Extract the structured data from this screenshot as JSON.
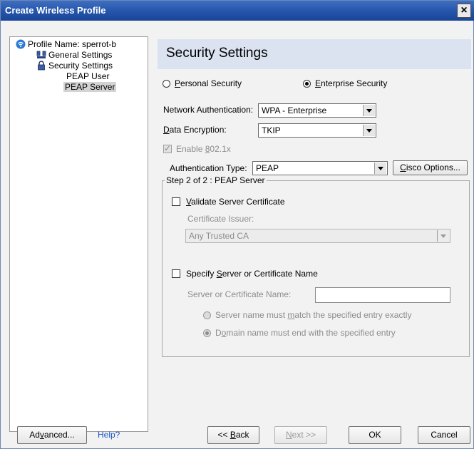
{
  "window": {
    "title": "Create Wireless Profile",
    "close_glyph": "×"
  },
  "tree": {
    "profile": "Profile Name: sperrot-b",
    "general": "General Settings",
    "security": "Security Settings",
    "peap_user": "PEAP User",
    "peap_server": "PEAP Server"
  },
  "panel": {
    "title": "Security Settings",
    "personal_prefix": "",
    "personal_key": "P",
    "personal_rest": "ersonal Security",
    "enterprise_key": "E",
    "enterprise_rest": "nterprise Security",
    "net_auth_label": "Network Authentication:",
    "net_auth_value": "WPA - Enterprise",
    "data_enc_key": "D",
    "data_enc_rest": "ata Encryption:",
    "data_enc_value": "TKIP",
    "enable_pre": "Enable ",
    "enable_key": "8",
    "enable_rest": "02.1x",
    "auth_type_label": "Authentication Type:",
    "auth_type_value": "PEAP",
    "cisco_key": "C",
    "cisco_rest": "isco Options...",
    "group_title": "Step 2 of 2 : PEAP Server",
    "validate_key": "V",
    "validate_rest": "alidate Server Certificate",
    "issuer_label": "Certificate Issuer:",
    "issuer_value": "Any Trusted CA",
    "specify_pre": "Specify ",
    "specify_key": "S",
    "specify_rest": "erver or Certificate Name",
    "server_name_label": "Server or Certificate Name:",
    "server_name_value": "",
    "match_pre": "Server name must ",
    "match_key": "m",
    "match_rest": "atch the specified entry exactly",
    "domain_pre": "D",
    "domain_key": "o",
    "domain_rest": "main name must end with the specified entry"
  },
  "footer": {
    "advanced_pre": "Ad",
    "advanced_key": "v",
    "advanced_rest": "anced...",
    "help": "Help?",
    "back_pre": "<< ",
    "back_key": "B",
    "back_rest": "ack",
    "next_pre": "",
    "next_key": "N",
    "next_rest": "ext >>",
    "ok": "OK",
    "cancel": "Cancel"
  },
  "colors": {
    "title_bar": "#2354ab",
    "header_band": "#dbe3f1",
    "link": "#1a55c9"
  },
  "icons": {
    "profile": "wifi-icon",
    "general": "network-icon",
    "security": "lock-icon"
  }
}
